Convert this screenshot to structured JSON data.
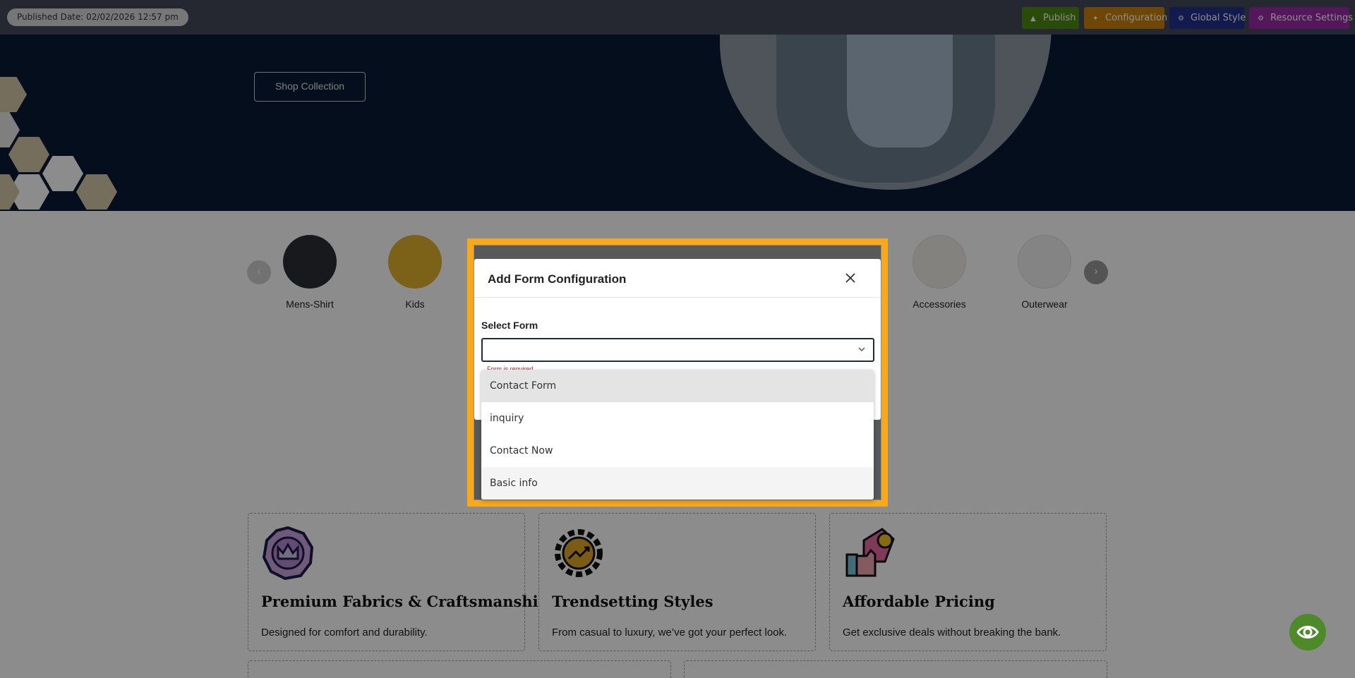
{
  "topbar": {
    "published_date": "Published Date: 02/02/2026 12:57 pm",
    "buttons": {
      "publish": "Publish",
      "configuration": "Configuration",
      "global_style": "Global Style",
      "resource_settings": "Resource Settings"
    }
  },
  "hero": {
    "shop_button": "Shop Collection"
  },
  "categories": {
    "items": [
      {
        "label": "Mens-Shirt"
      },
      {
        "label": "Kids"
      },
      {
        "label": "Accessories"
      },
      {
        "label": "Outerwear"
      }
    ]
  },
  "features": [
    {
      "title": "Premium Fabrics & Craftsmanship",
      "desc": "Designed for comfort and durability."
    },
    {
      "title": "Trendsetting Styles",
      "desc": "From casual to luxury, we’ve got your perfect look."
    },
    {
      "title": "Affordable Pricing",
      "desc": "Get exclusive deals without breaking the bank."
    }
  ],
  "modal": {
    "title": "Add Form Configuration",
    "field_label": "Select Form",
    "select_value": "",
    "error_text": "Form is required",
    "options": [
      {
        "label": "Contact Form"
      },
      {
        "label": "inquiry"
      },
      {
        "label": "Contact Now"
      },
      {
        "label": "Basic info"
      }
    ]
  },
  "colors": {
    "accent_highlight": "#f7a81b",
    "publish": "#4e8a14",
    "configuration": "#c8800a",
    "global_style": "#23318e",
    "resource_settings": "#9a2aa6"
  }
}
